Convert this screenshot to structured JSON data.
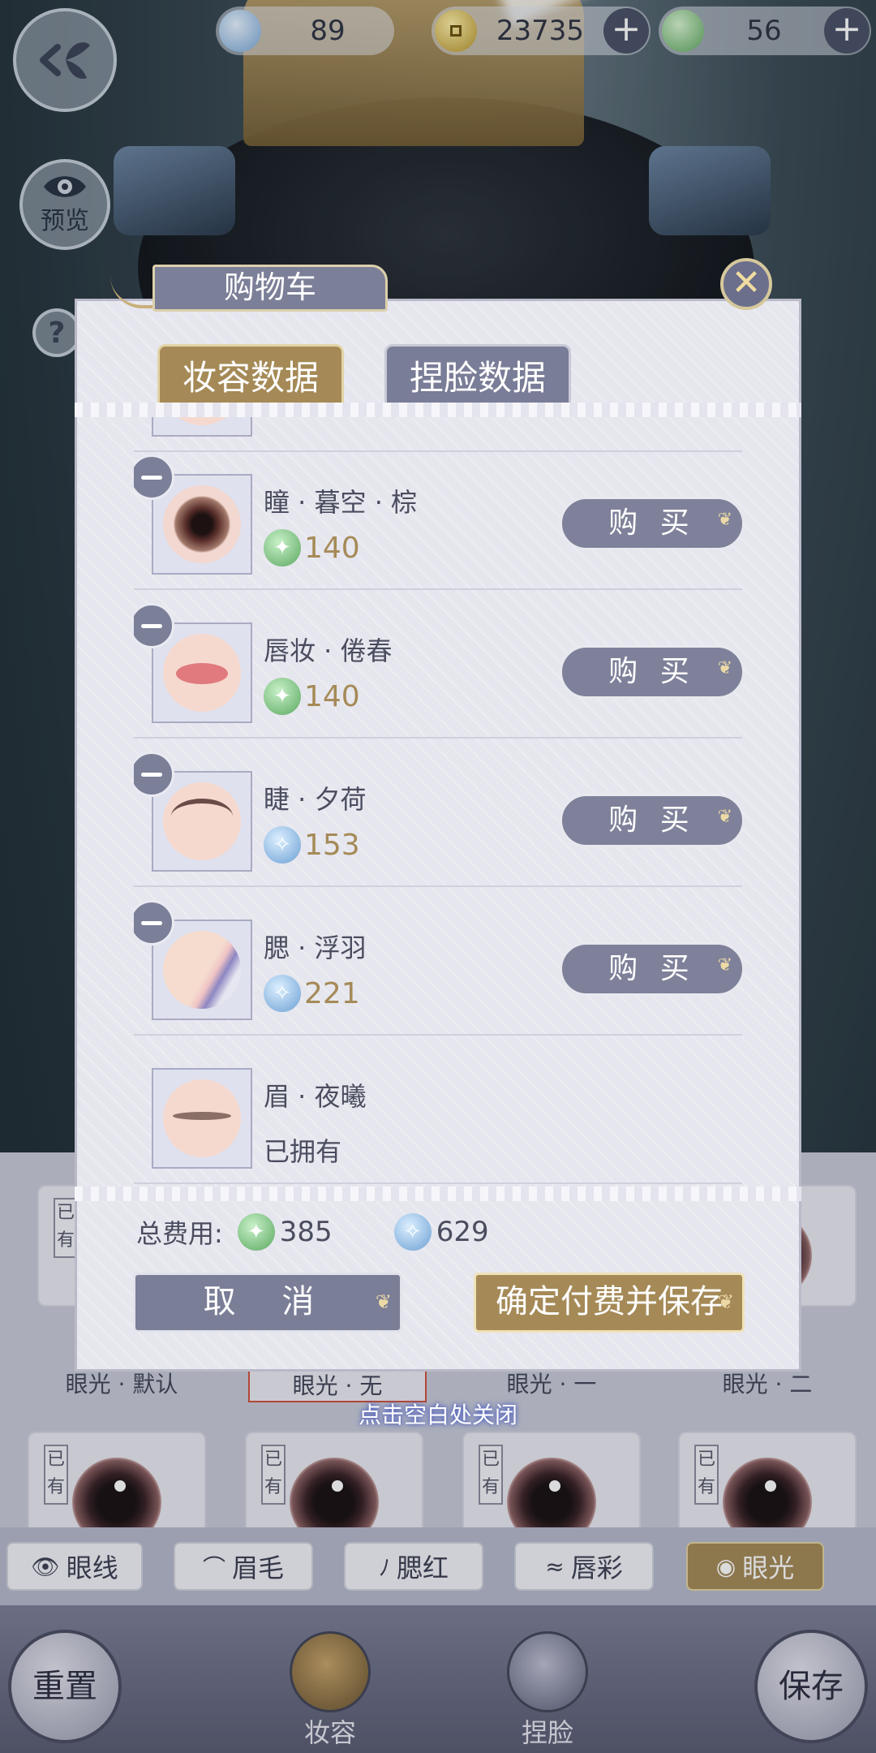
{
  "hud": {
    "currency": [
      {
        "icon": "blue-jade-icon",
        "value": "89"
      },
      {
        "icon": "copper-coin-icon",
        "value": "23735"
      },
      {
        "icon": "green-jade-icon",
        "value": "56"
      }
    ],
    "preview_label": "预览",
    "help_label": "?"
  },
  "modal": {
    "title": "购物车",
    "tabs": [
      "妆容数据",
      "捏脸数据"
    ],
    "items": [
      {
        "name": "瞳 · 暮空 · 棕",
        "currency": "green",
        "price": "140",
        "buy": "购 买",
        "art": "eye"
      },
      {
        "name": "唇妆 · 倦春",
        "currency": "green",
        "price": "140",
        "buy": "购 买",
        "art": "lips"
      },
      {
        "name": "睫 · 夕荷",
        "currency": "blue",
        "price": "153",
        "buy": "购 买",
        "art": "lash"
      },
      {
        "name": "腮 · 浮羽",
        "currency": "blue",
        "price": "221",
        "buy": "购 买",
        "art": "blush"
      },
      {
        "name": "眉 · 夜曦",
        "owned": "已拥有",
        "art": "brow"
      }
    ],
    "total_label": "总费用:",
    "total_green": "385",
    "total_blue": "629",
    "cancel": "取 消",
    "confirm": "确定付费并保存"
  },
  "close_hint": "点击空白处关闭",
  "grid": {
    "owned_tag": "已有",
    "labels": [
      "眼光 · 默认",
      "眼光 · 无",
      "眼光 · 一",
      "眼光 · 二"
    ]
  },
  "categories": [
    "眼线",
    "眉毛",
    "腮红",
    "唇彩",
    "眼光"
  ],
  "nav": {
    "reset": "重置",
    "makeup": "妆容",
    "face": "捏脸",
    "save": "保存"
  },
  "colors": {
    "gold": "#a58a57",
    "slate": "#7b7e97",
    "panel": "#e6e6ee"
  }
}
